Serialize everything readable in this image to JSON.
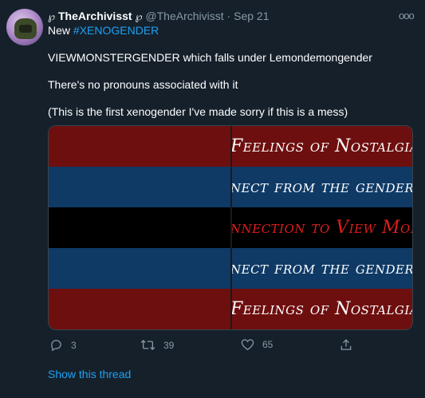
{
  "tweet": {
    "glyph_left": "℘",
    "display_name": "TheArchivisst",
    "glyph_right": "℘",
    "handle": "@TheArchivisst",
    "separator": "·",
    "time": "Sep 21",
    "more_label": "ooo",
    "line1_prefix": "New",
    "hashtag": "#XENOGENDER",
    "paragraphs": [
      "VIEWMONSTERGENDER which falls under Lemondemongender",
      "There's no pronouns associated with it",
      "(This is the first xenogender I've made sorry if this is a mess)"
    ],
    "show_thread": "Show this thread"
  },
  "flag": {
    "stripes": [
      {
        "color": "#6e0f0f",
        "text": "Feelings of Nostalgia",
        "text_color": "#ffffff"
      },
      {
        "color": "#0f3a66",
        "text": "nect from the gender",
        "text_color": "#ffffff"
      },
      {
        "color": "#000000",
        "text": "nnection to View Monst",
        "text_color": "#e01c1c"
      },
      {
        "color": "#0f3a66",
        "text": "nect from the gender",
        "text_color": "#ffffff"
      },
      {
        "color": "#6e0f0f",
        "text": "Feelings of Nostalgia",
        "text_color": "#ffffff"
      }
    ]
  },
  "actions": {
    "reply": {
      "icon": "reply-icon",
      "count": "3"
    },
    "retweet": {
      "icon": "retweet-icon",
      "count": "39"
    },
    "like": {
      "icon": "heart-icon",
      "count": "65"
    },
    "share": {
      "icon": "share-icon"
    }
  },
  "colors": {
    "background": "#15202b",
    "link": "#1da1f2",
    "muted": "#8899a6"
  }
}
